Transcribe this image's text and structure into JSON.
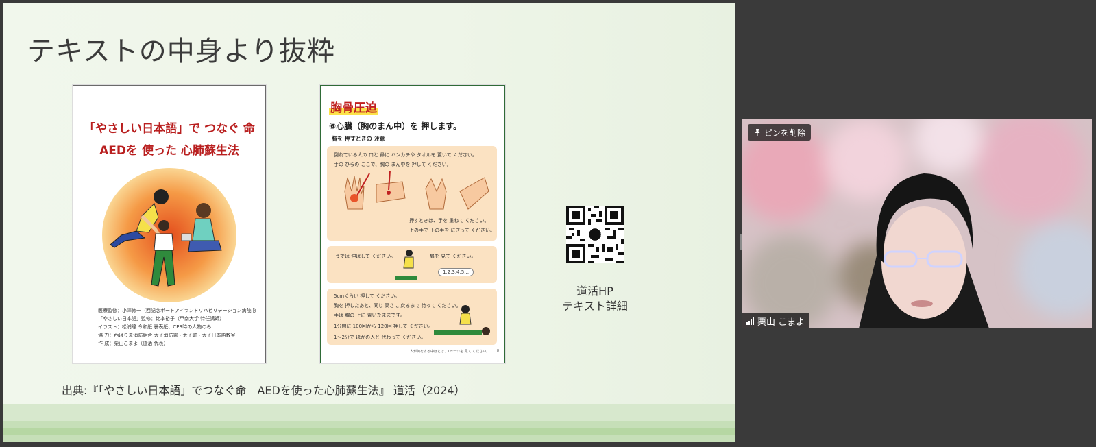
{
  "slide": {
    "title": "テキストの中身より抜粋",
    "cover": {
      "title_line1": "「やさしい日本語」で つなぐ 命",
      "title_line2": "AEDを 使った 心肺蘇生法",
      "credits": [
        "医療監修：小澤修一（西記念ポートアイランドリハビリテーション病院 院長）",
        "「やさしい日本語」監修：比本裕子（甲南大学 特任講師）",
        "イラスト：松浦瞳 令和紙 裏表紙、CPR時の人物のみ",
        "協 力：西はりま消防組合 太子消防署・太子町・太子日本語教室",
        "作 成：栗山こまよ（道活 代表）"
      ]
    },
    "inner": {
      "heading": "胸骨圧迫",
      "sub1": "⑥心臓（胸のまん中）を 押します。",
      "sub2": "胸を 押すときの 注意",
      "panel1_lines": [
        "倒れている人の 口と 鼻に ハンカチや タオルを 置いて ください。",
        "手の ひらの ここで、胸の まん中を 押して ください。",
        "押すときは、手を 重ねて ください。",
        "上の手で 下の手を にぎって ください。"
      ],
      "panel2_lines": [
        "うでは 伸ばして ください。",
        "肩を 見て ください。",
        "1,2,3,4,5…"
      ],
      "panel3_lines": [
        "5cmくらい 押して ください。",
        "胸を 押したあと、同じ 高さに 戻るまで 待って ください。",
        "手は 胸の 上に 置いたままです。",
        "1分間に 100回から 120回 押して ください。",
        "1～2分で ほかの人と 代わって ください。"
      ],
      "footer": "人が何をする中ほとは、1ページを 見て ください。",
      "page_number": "8"
    },
    "qr_caption_line1": "道活HP",
    "qr_caption_line2": "テキスト詳細",
    "source": "出典:『「やさしい日本語」でつなぐ命　AEDを使った心肺蘇生法』 道活（2024）"
  },
  "video": {
    "pin_label": "ピンを削除",
    "pin_icon": "pin-icon",
    "participant_name": "栗山 こまよ",
    "signal_icon": "signal-bars-icon"
  },
  "colors": {
    "slide_bg": "#eef5e8",
    "title_red": "#b91f1f",
    "panel_bg": "#fbe2c2",
    "app_bg": "#3a3a3a"
  }
}
